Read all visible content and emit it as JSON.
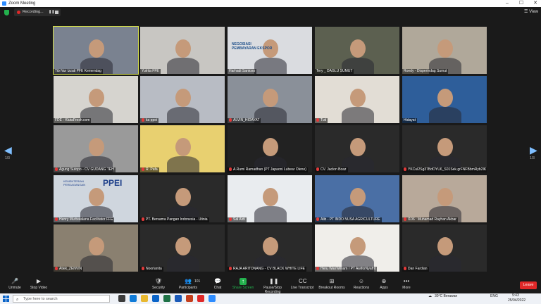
{
  "window": {
    "title": "Zoom Meeting",
    "minimize": "–",
    "maximize": "☐",
    "close": "✕"
  },
  "topbar": {
    "recording_label": "Recording...",
    "pause_icon": "❚❚",
    "view_label": "View"
  },
  "navigation": {
    "left_arrow": "◀",
    "right_arrow": "▶",
    "left_page": "1/3",
    "right_page": "1/3"
  },
  "participants": [
    {
      "name": "Tib Nur Izzati PFE Kemendag",
      "bg": "#7a8290",
      "muted": false
    },
    {
      "name": "Yulrita FFE",
      "bg": "#c8c6c2",
      "muted": false
    },
    {
      "name": "Harhadi Santoso",
      "bg": "#dadce0",
      "muted": false
    },
    {
      "name": "Tery _ DAGLU SUMUT",
      "bg": "#5c6050",
      "muted": false
    },
    {
      "name": "Roedy - Disperindag Sumut",
      "bg": "#b0a89a",
      "muted": false
    },
    {
      "name": "FDE - KlutaFresh.com",
      "bg": "#d6d4cf",
      "muted": false
    },
    {
      "name": "ka ppei",
      "bg": "#b8bcc4",
      "muted": true
    },
    {
      "name": "ALVIN_HIDAYAT",
      "bg": "#8a9099",
      "muted": true
    },
    {
      "name": "Tuti",
      "bg": "#e2ddd5",
      "muted": true
    },
    {
      "name": "Hidayat",
      "bg": "#2e5e9a",
      "muted": false
    },
    {
      "name": "Agung Sutopo - CV GUDANG TEH",
      "bg": "#9a9a9a",
      "muted": true
    },
    {
      "name": "R. Pafa",
      "bg": "#e8d070",
      "muted": true
    },
    {
      "name": "A.Rumi Ramadhan (PT Japaoni Lubear Oleno)",
      "bg": "#222222",
      "muted": true
    },
    {
      "name": "CV. Jaclon Boaz",
      "bg": "#2a2a2a",
      "muted": true
    },
    {
      "name": "YKCuI2Sg37BdOYU6_S01Sek.grFNFBbmRyb2IK",
      "bg": "#2a2a2a",
      "muted": true
    },
    {
      "name": "Henry Murbatalana Facilitator FFE",
      "bg": "#cfd6de",
      "muted": true
    },
    {
      "name": "PT. Bersama Pangan Indonesia - Utinia",
      "bg": "#2a2a2a",
      "muted": true
    },
    {
      "name": "Sal Aldi",
      "bg": "#e9ecef",
      "muted": true
    },
    {
      "name": "Alib - PT INDO NUSA AGRICULTURE",
      "bg": "#4a6fa5",
      "muted": true
    },
    {
      "name": "I106 : Muhamad Rayhan Akbar",
      "bg": "#b8a99a",
      "muted": true
    },
    {
      "name": "Atiek_ZENVIN",
      "bg": "#8a8070",
      "muted": true
    },
    {
      "name": "Noorlanita",
      "bg": "#2a2a2a",
      "muted": true
    },
    {
      "name": "RAJA ARITONANG - CV BLACK WHITE LIFE",
      "bg": "#2a2a2a",
      "muted": true
    },
    {
      "name": "Heru WanWilliam / PT AwiforNyafrit",
      "bg": "#f0eeea",
      "muted": true
    },
    {
      "name": "Dan Fardian",
      "bg": "#2a2a2a",
      "muted": true
    }
  ],
  "slide_texts": {
    "negosiasi": "NEGOSIASI PEMBAYARAN EKSPOR",
    "ppei": "PPEI",
    "kementerian": "KEMENTERIAN PERDAGANGAN"
  },
  "toolbar": [
    {
      "label": "Unmute",
      "icon": "🎤",
      "green": false
    },
    {
      "label": "Stop Video",
      "icon": "▶",
      "green": false
    },
    {
      "label": "Security",
      "icon": "🛡",
      "green": false
    },
    {
      "label": "Participants",
      "icon": "👥",
      "green": false
    },
    {
      "label": "Chat",
      "icon": "💬",
      "green": false
    },
    {
      "label": "Share Screen",
      "icon": "↑",
      "green": true
    },
    {
      "label": "Pause/Stop Recording",
      "icon": "❚❚",
      "green": false
    },
    {
      "label": "Live Transcript",
      "icon": "CC",
      "green": false
    },
    {
      "label": "Breakout Rooms",
      "icon": "⊞",
      "green": false
    },
    {
      "label": "Reactions",
      "icon": "☺",
      "green": false
    },
    {
      "label": "Apps",
      "icon": "⊕",
      "green": false
    },
    {
      "label": "More",
      "icon": "•••",
      "green": false
    }
  ],
  "participant_count": "101",
  "leave_label": "Leave",
  "taskbar": {
    "search_placeholder": "Type here to search",
    "weather": "30°C Berawan",
    "language": "ENG",
    "time": "9:43",
    "date": "25/04/2022"
  }
}
